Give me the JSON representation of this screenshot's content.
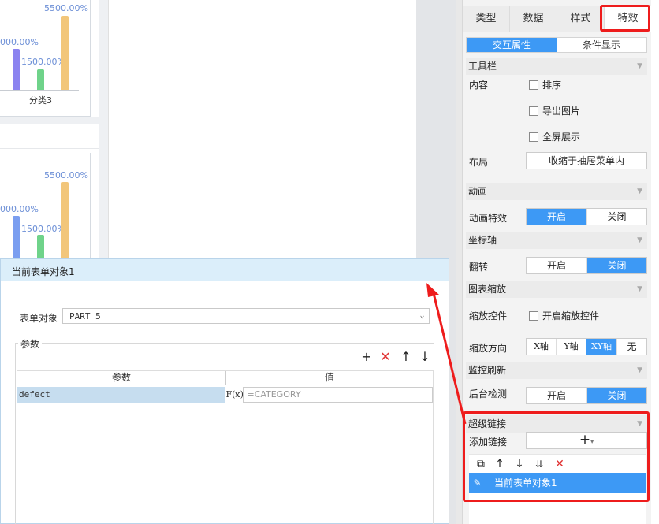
{
  "preview": {
    "chart1": {
      "bar_labels": [
        "5500.00%",
        "000.00%",
        "1500.00%"
      ],
      "category": "分类3"
    },
    "chart2": {
      "bar_labels": [
        "5500.00%",
        "000.00%",
        "1500.00%"
      ]
    }
  },
  "dialog": {
    "title": "当前表单对象1",
    "form_object_label": "表单对象",
    "form_object_value": "PART_5",
    "params_label": "参数",
    "table": {
      "col_param": "参数",
      "col_value": "值",
      "rows": [
        {
          "name": "defect",
          "fx": "F(x)",
          "value": "=CATEGORY"
        }
      ]
    }
  },
  "panel": {
    "tabs": [
      "类型",
      "数据",
      "样式",
      "特效"
    ],
    "active_tab": "特效",
    "subtabs": [
      "交互属性",
      "条件显示"
    ],
    "toolbar_section": "工具栏",
    "content_label": "内容",
    "cb_sort": "排序",
    "cb_export": "导出图片",
    "cb_fullscreen": "全屏展示",
    "layout_label": "布局",
    "layout_value": "收缩于抽屉菜单内",
    "anim_section": "动画",
    "anim_effect_label": "动画特效",
    "on": "开启",
    "off": "关闭",
    "axis_section": "坐标轴",
    "flip_label": "翻转",
    "zoom_section": "图表缩放",
    "zoom_ctrl_label": "缩放控件",
    "zoom_ctrl_cb": "开启缩放控件",
    "zoom_dir_label": "缩放方向",
    "zoom_dirs": [
      "X轴",
      "Y轴",
      "XY轴",
      "无"
    ],
    "monitor_section": "监控刷新",
    "bg_check_label": "后台检测",
    "hyperlink_section": "超级链接",
    "add_link_label": "添加链接",
    "link_item": "当前表单对象1"
  },
  "colors": {
    "accent": "#3d99f5",
    "highlight": "#ee1c1c"
  }
}
